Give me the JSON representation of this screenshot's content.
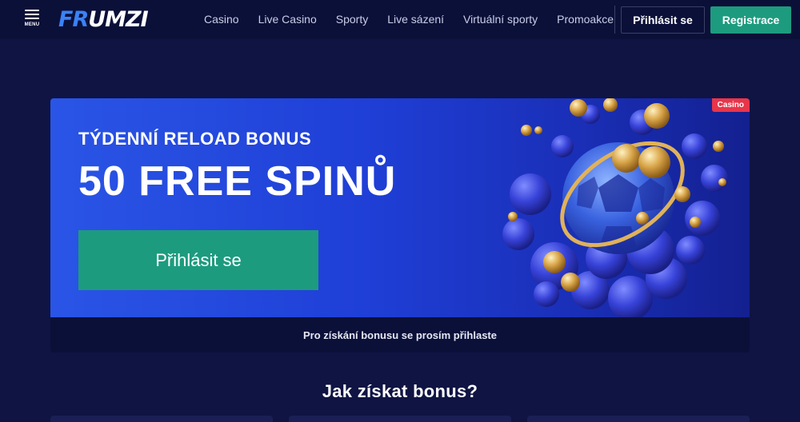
{
  "header": {
    "menu_label": "MENU",
    "logo_text_first": "FR",
    "logo_text_rest": "UMZI",
    "nav": [
      "Casino",
      "Live Casino",
      "Sporty",
      "Live sázení",
      "Virtuální sporty",
      "Promoakce"
    ],
    "login_label": "Přihlásit se",
    "register_label": "Registrace"
  },
  "banner": {
    "badge": "Casino",
    "subtitle": "TÝDENNÍ RELOAD BONUS",
    "title": "50 FREE SPINŮ",
    "cta_label": "Přihlásit se",
    "footer_note": "Pro získání bonusu se prosím přihlaste"
  },
  "section": {
    "title": "Jak získat bonus?"
  },
  "colors": {
    "page_bg": "#0f1443",
    "header_bg": "#0b1039",
    "accent_green": "#1d9b7f",
    "banner_blue": "#2a55e6",
    "badge_red": "#e8354a",
    "logo_blue": "#3b82f6"
  }
}
